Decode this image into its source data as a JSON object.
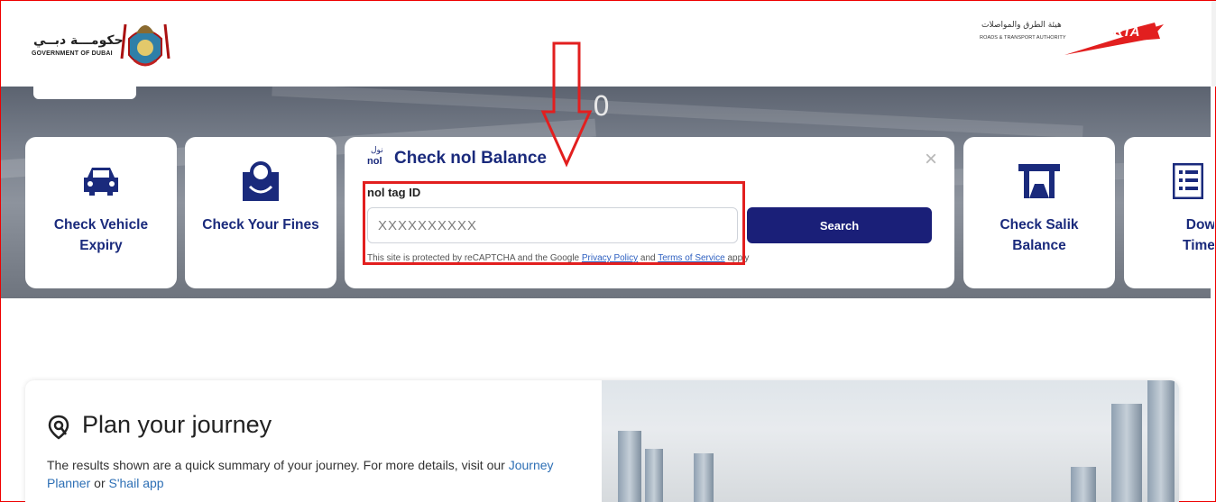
{
  "header": {
    "gov_logo_ar": "حكومـــة دبــي",
    "gov_logo_en": "GOVERNMENT OF DUBAI",
    "rta_ar": "هيئة الطرق والمواصلات",
    "rta_en": "ROADS & TRANSPORT AUTHORITY",
    "rta_mark": "RTA"
  },
  "hero": {
    "overlay_char": "0"
  },
  "cards": {
    "vehicle": {
      "label_line1": "Check Vehicle",
      "label_line2": "Expiry",
      "icon": "car-icon"
    },
    "fines": {
      "label": "Check Your Fines",
      "icon": "fines-icon"
    },
    "salik": {
      "label_line1": "Check Salik",
      "label_line2": "Balance",
      "icon": "salik-gate-icon"
    },
    "timetable": {
      "label_line1": "Downl",
      "label_line2": "Timetal",
      "icon": "timetable-icon"
    }
  },
  "nol": {
    "logo_ar": "نول",
    "logo_en": "nol",
    "title": "Check nol Balance",
    "field_label": "nol tag ID",
    "placeholder": "XXXXXXXXXX",
    "value": "",
    "search_label": "Search",
    "recaptcha_prefix": "This site is protected by reCAPTCHA and the Google ",
    "privacy_link": "Privacy Policy",
    "and_text": " and ",
    "terms_link": "Terms of Service",
    "recaptcha_suffix": " apply",
    "close_icon": "close-icon"
  },
  "journey": {
    "title": "Plan your journey",
    "desc_prefix": "The results shown are a quick summary of your journey. For more details, visit our ",
    "journey_link": "Journey",
    "planner_link": "Planner",
    "or_text": " or ",
    "shail_link": "S'hail app"
  },
  "colors": {
    "brand_navy": "#1a2a7c",
    "button": "#1a1f78",
    "annotation": "#e21f1f",
    "rta_red": "#e21f1f"
  }
}
